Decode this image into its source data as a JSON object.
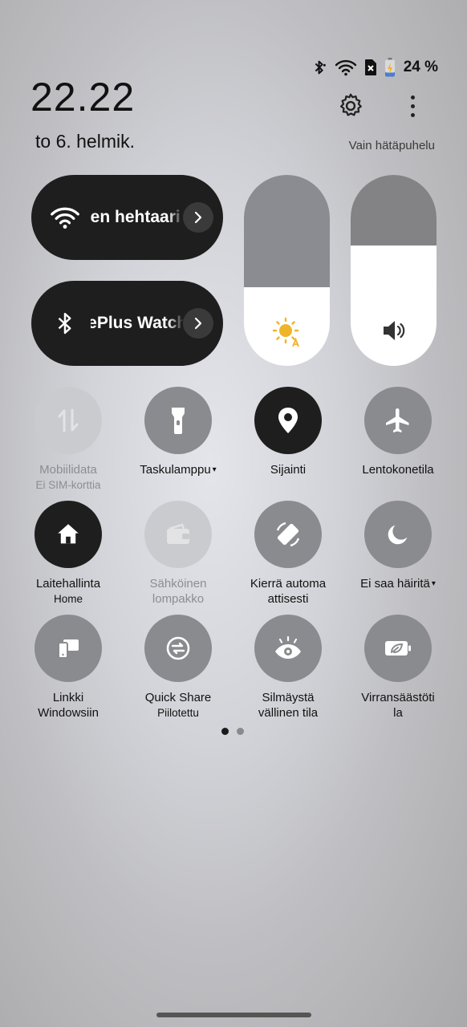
{
  "status_bar": {
    "icons": [
      "bluetooth-icon",
      "wifi-icon",
      "no-sim-icon",
      "battery-charging-icon"
    ],
    "battery_percent": "24 %"
  },
  "header": {
    "time": "22.22",
    "date": "to 6. helmik.",
    "emergency_text": "Vain hätäpuhelu",
    "settings_icon": "gear-icon",
    "more_icon": "more-vertical-icon"
  },
  "connections": {
    "wifi": {
      "label": "Ilen hehtaari",
      "icon": "wifi-icon"
    },
    "bluetooth": {
      "label": "OnePlus Watch",
      "icon": "bluetooth-icon"
    }
  },
  "sliders": {
    "brightness": {
      "icon": "sun-auto-icon",
      "level": 0.41
    },
    "volume": {
      "icon": "speaker-icon",
      "level": 0.63
    }
  },
  "tiles": [
    {
      "label": "Mobiilidata",
      "sub": "Ei SIM-korttia",
      "icon": "mobile-data-icon",
      "state": "disabled"
    },
    {
      "label": "Taskulamppu",
      "sub": "",
      "icon": "flashlight-icon",
      "state": "off",
      "caret": "▾"
    },
    {
      "label": "Sijainti",
      "sub": "",
      "icon": "location-pin-icon",
      "state": "on"
    },
    {
      "label": "Lentokonetila",
      "sub": "",
      "icon": "airplane-icon",
      "state": "off"
    },
    {
      "label": "Laitehallinta",
      "sub": "Home",
      "icon": "home-icon",
      "state": "on"
    },
    {
      "label": "Sähköinen",
      "label2": "lompakko",
      "sub": "",
      "icon": "wallet-icon",
      "state": "disabled"
    },
    {
      "label": "Kierrä automa",
      "label2": "attisesti",
      "sub": "",
      "icon": "auto-rotate-icon",
      "state": "off"
    },
    {
      "label": "Ei saa häiritä",
      "sub": "",
      "icon": "moon-icon",
      "state": "off",
      "caret": "▾"
    },
    {
      "label": "Linkki",
      "label2": "Windowsiin",
      "sub": "",
      "icon": "link-to-windows-icon",
      "state": "off"
    },
    {
      "label": "Quick Share",
      "sub": "Piilotettu",
      "icon": "quick-share-icon",
      "state": "off"
    },
    {
      "label": "Silmäystä",
      "label2": "vällinen tila",
      "sub": "",
      "icon": "eye-comfort-icon",
      "state": "off"
    },
    {
      "label": "Virransäästöti",
      "label2": "la",
      "sub": "",
      "icon": "power-saving-icon",
      "state": "off"
    }
  ],
  "pager": {
    "page": 1,
    "total": 2,
    "active_color": "#1a1a1a",
    "inactive_color": "#8a8a8e"
  },
  "colors": {
    "tile_on": "#1e1e1e",
    "tile_off": "#8a8b8f",
    "tile_disabled": "#cacbce",
    "accent": "#f0b429"
  }
}
